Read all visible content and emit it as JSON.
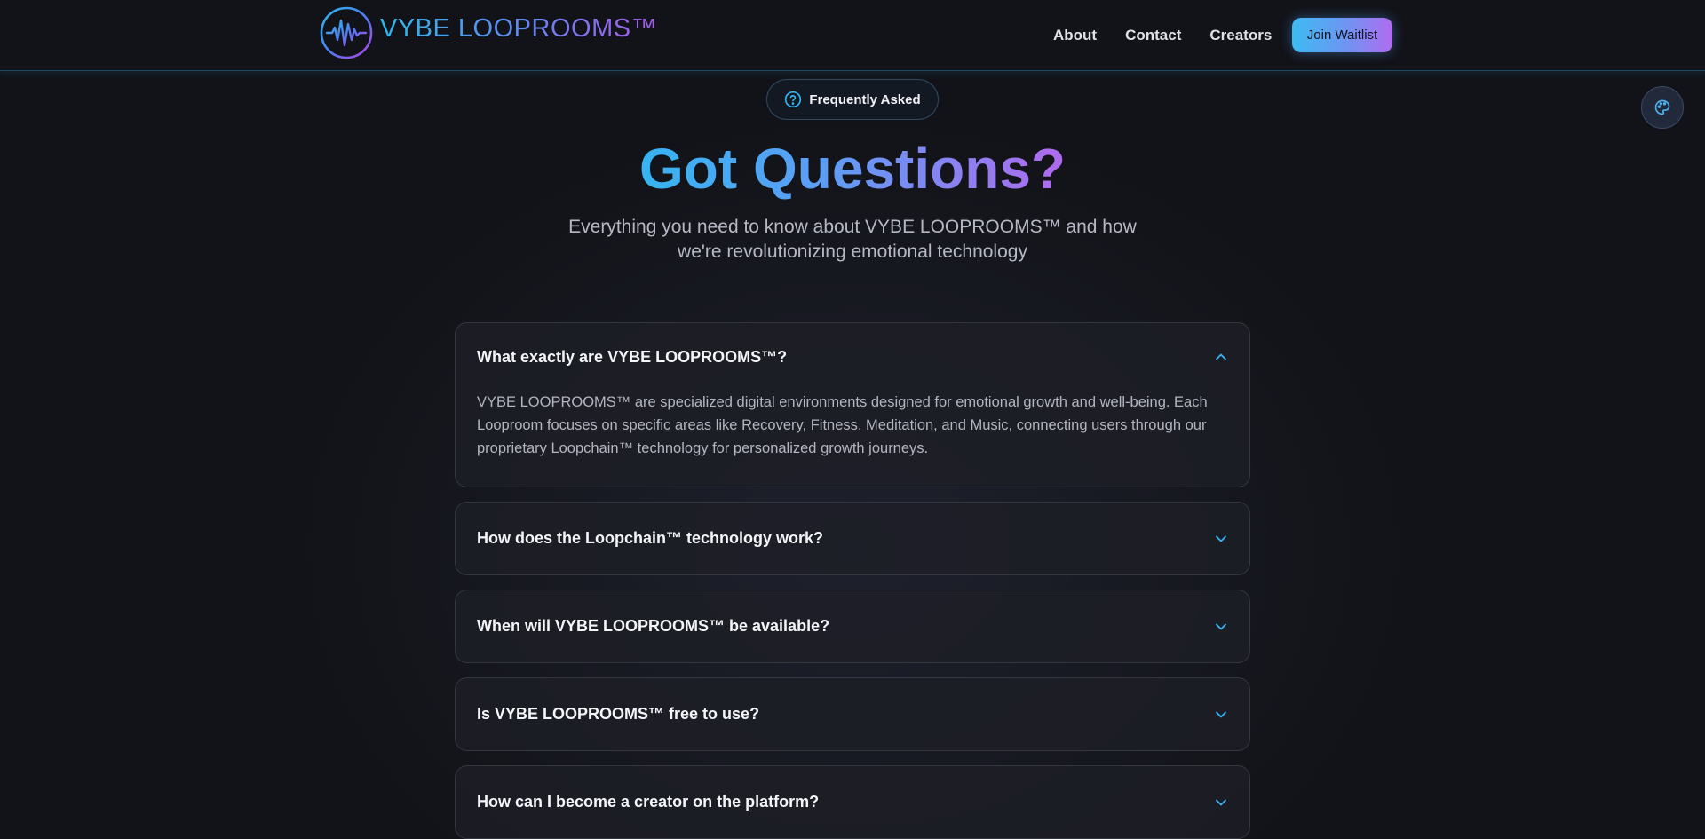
{
  "brand": {
    "name": "VYBE LOOPROOMS™"
  },
  "nav": {
    "links": [
      "About",
      "Contact",
      "Creators"
    ],
    "cta": "Join Waitlist"
  },
  "hero": {
    "badge": "Frequently Asked",
    "title": "Got Questions?",
    "subtitle": "Everything you need to know about VYBE LOOPROOMS™ and how we're revolutionizing emotional technology"
  },
  "faq": [
    {
      "question": "What exactly are VYBE LOOPROOMS™?",
      "answer": "VYBE LOOPROOMS™ are specialized digital environments designed for emotional growth and well-being. Each Looproom focuses on specific areas like Recovery, Fitness, Meditation, and Music, connecting users through our proprietary Loopchain™ technology for personalized growth journeys.",
      "expanded": true
    },
    {
      "question": "How does the Loopchain™ technology work?",
      "expanded": false
    },
    {
      "question": "When will VYBE LOOPROOMS™ be available?",
      "expanded": false
    },
    {
      "question": "Is VYBE LOOPROOMS™ free to use?",
      "expanded": false
    },
    {
      "question": "How can I become a creator on the platform?",
      "expanded": false
    }
  ],
  "colors": {
    "accent_cyan": "#36b4f2",
    "accent_purple": "#b06aee",
    "background": "#121318"
  },
  "icons": {
    "logo": "waveform-circle-icon",
    "badge": "question-circle-icon",
    "theme": "palette-icon",
    "expanded": "chevron-up-icon",
    "collapsed": "chevron-down-icon"
  }
}
